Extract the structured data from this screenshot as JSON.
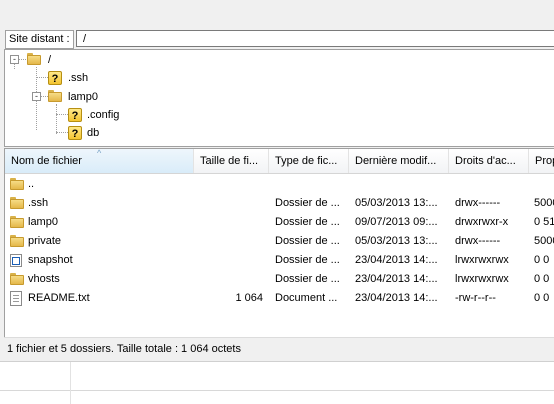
{
  "remote": {
    "label": "Site distant :",
    "path": "/"
  },
  "tree": {
    "nodes": [
      {
        "label": "/",
        "icon": "folder-open-icon",
        "toggle": "-"
      },
      {
        "label": ".ssh",
        "icon": "unknown-folder-icon"
      },
      {
        "label": "lamp0",
        "icon": "folder-open-icon",
        "toggle": "-"
      },
      {
        "label": ".config",
        "icon": "unknown-folder-icon"
      },
      {
        "label": "db",
        "icon": "unknown-folder-icon"
      }
    ]
  },
  "table": {
    "sort_indicator": "^",
    "columns": [
      "Nom de fichier",
      "Taille de fi...",
      "Type de fic...",
      "Dernière modif...",
      "Droits d'ac...",
      "Prop"
    ],
    "rows": [
      {
        "icon": "folder-icon",
        "name": "..",
        "size": "",
        "type": "",
        "modified": "",
        "perms": "",
        "owner": ""
      },
      {
        "icon": "folder-icon",
        "name": ".ssh",
        "size": "",
        "type": "Dossier de ...",
        "modified": "05/03/2013 13:...",
        "perms": "drwx------",
        "owner": "5000"
      },
      {
        "icon": "folder-icon",
        "name": "lamp0",
        "size": "",
        "type": "Dossier de ...",
        "modified": "09/07/2013 09:...",
        "perms": "drwxrwxr-x",
        "owner": "0 51"
      },
      {
        "icon": "folder-icon",
        "name": "private",
        "size": "",
        "type": "Dossier de ...",
        "modified": "05/03/2013 13:...",
        "perms": "drwx------",
        "owner": "5000"
      },
      {
        "icon": "link-icon",
        "name": "snapshot",
        "size": "",
        "type": "Dossier de ...",
        "modified": "23/04/2013 14:...",
        "perms": "lrwxrwxrwx",
        "owner": "0 0"
      },
      {
        "icon": "folder-icon",
        "name": "vhosts",
        "size": "",
        "type": "Dossier de ...",
        "modified": "23/04/2013 14:...",
        "perms": "lrwxrwxrwx",
        "owner": "0 0"
      },
      {
        "icon": "text-file-icon",
        "name": "README.txt",
        "size": "1 064",
        "type": "Document ...",
        "modified": "23/04/2013 14:...",
        "perms": "-rw-r--r--",
        "owner": "0 0"
      }
    ]
  },
  "status": {
    "text": "1 fichier et 5 dossiers. Taille totale : 1 064 octets"
  }
}
